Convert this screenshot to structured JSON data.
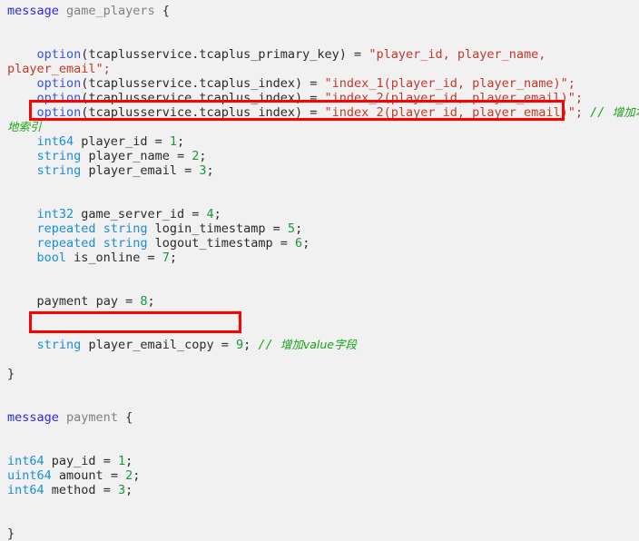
{
  "document": {
    "kind": "protobuf-idl-source",
    "background_color": "#f1f1f1",
    "colors": {
      "keyword": "#2b2bd4",
      "option_keyword": "#3355dd",
      "type": "#1c8fd4",
      "string_literal": "#c0392b",
      "number": "#1a9641",
      "plain_text": "#2b2b2b",
      "struct_name": "#808080",
      "annotation_green": "#17a317",
      "callout_red": "#ff0000"
    }
  },
  "code": {
    "msg1_header": {
      "keyword": "message",
      "name": "game_players",
      "brace": "{"
    },
    "option_primary_key": {
      "keyword": "option",
      "open": "(",
      "path": "tcaplusservice.tcaplus_primary_key",
      "close": ")",
      "equals": " = ",
      "value_line1": "\"player_id, player_name,",
      "value_line2": "player_email\";"
    },
    "option_index_1": {
      "keyword": "option",
      "open": "(",
      "path": "tcaplusservice.tcaplus_index",
      "close": ")",
      "equals": " = ",
      "value": "\"index_1(player_id, player_name)\";"
    },
    "option_index_2": {
      "keyword": "option",
      "open": "(",
      "path": "tcaplusservice.tcaplus_index",
      "close": ")",
      "equals": " = ",
      "value": "\"index_2(player_id, player_email)\";"
    },
    "option_index_2_added": {
      "keyword": "option",
      "open": "(",
      "path": "tcaplusservice.tcaplus_index",
      "close": ")",
      "equals": " = ",
      "value": "\"index_2(player_id, player_email)\";",
      "annotation_slashes": "//",
      "annotation_text_part1": "增加本",
      "annotation_text_part2": "地索引",
      "annotation_full": "// 增加本地索引"
    },
    "fields_group_1": [
      {
        "type": "int64",
        "name": "player_id",
        "eq": " = ",
        "tag": "1",
        "semi": ";"
      },
      {
        "type": "string",
        "name": "player_name",
        "eq": " = ",
        "tag": "2",
        "semi": ";"
      },
      {
        "type": "string",
        "name": "player_email",
        "eq": " = ",
        "tag": "3",
        "semi": ";"
      }
    ],
    "fields_group_2": [
      {
        "modifier": "",
        "type": "int32",
        "name": "game_server_id",
        "eq": " = ",
        "tag": "4",
        "semi": ";"
      },
      {
        "modifier": "repeated",
        "type": "string",
        "name": "login_timestamp",
        "eq": " = ",
        "tag": "5",
        "semi": ";"
      },
      {
        "modifier": "repeated",
        "type": "string",
        "name": "logout_timestamp",
        "eq": " = ",
        "tag": "6",
        "semi": ";"
      },
      {
        "modifier": "",
        "type": "bool",
        "name": "is_online",
        "eq": " = ",
        "tag": "7",
        "semi": ";"
      }
    ],
    "field_payment_pay": {
      "type": "payment",
      "name": "pay",
      "eq": " = ",
      "tag": "8",
      "semi": ";"
    },
    "field_player_email_copy": {
      "type": "string",
      "name": "player_email_copy",
      "eq": " = ",
      "tag": "9",
      "semi": ";",
      "annotation_slashes": "//",
      "annotation_text": "增加value字段",
      "annotation_full": "// 增加value字段"
    },
    "msg1_close_brace": "}",
    "msg2_header": {
      "keyword": "message",
      "name": "payment",
      "brace": "{"
    },
    "msg2_fields": [
      {
        "type": "int64",
        "name": "pay_id",
        "eq": " = ",
        "tag": "1",
        "semi": ";"
      },
      {
        "type": "uint64",
        "name": "amount",
        "eq": " = ",
        "tag": "2",
        "semi": ";"
      },
      {
        "type": "int64",
        "name": "method",
        "eq": " = ",
        "tag": "3",
        "semi": ";"
      }
    ],
    "msg2_close_brace": "}"
  },
  "callouts": {
    "box_index_line_label": "highlighted added index option",
    "box_copy_field_label": "highlighted added value field"
  }
}
